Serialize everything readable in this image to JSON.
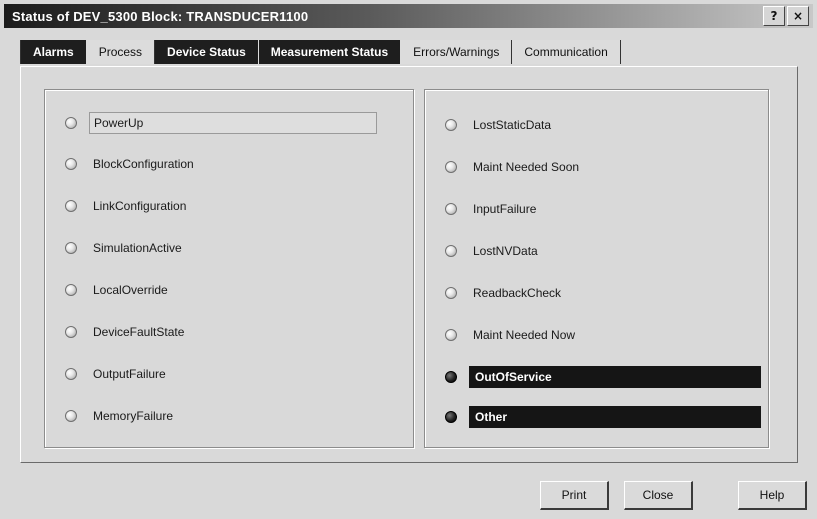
{
  "window": {
    "title": "Status of DEV_5300 Block: TRANSDUCER1100",
    "help_glyph": "?",
    "close_glyph": "×"
  },
  "tabs": [
    {
      "label": "Alarms",
      "style": "dark"
    },
    {
      "label": "Process",
      "style": "light"
    },
    {
      "label": "Device Status",
      "style": "dark"
    },
    {
      "label": "Measurement Status",
      "style": "dark"
    },
    {
      "label": "Errors/Warnings",
      "style": "light"
    },
    {
      "label": "Communication",
      "style": "light"
    }
  ],
  "left_group": {
    "items": [
      {
        "label": "PowerUp",
        "state": "off",
        "focused": true
      },
      {
        "label": "BlockConfiguration",
        "state": "off"
      },
      {
        "label": "LinkConfiguration",
        "state": "off"
      },
      {
        "label": "SimulationActive",
        "state": "off"
      },
      {
        "label": "LocalOverride",
        "state": "off"
      },
      {
        "label": "DeviceFaultState",
        "state": "off"
      },
      {
        "label": "OutputFailure",
        "state": "off"
      },
      {
        "label": "MemoryFailure",
        "state": "off"
      }
    ]
  },
  "right_group": {
    "items": [
      {
        "label": "LostStaticData",
        "state": "off"
      },
      {
        "label": "Maint Needed Soon",
        "state": "off"
      },
      {
        "label": "InputFailure",
        "state": "off"
      },
      {
        "label": "LostNVData",
        "state": "off"
      },
      {
        "label": "ReadbackCheck",
        "state": "off"
      },
      {
        "label": "Maint Needed Now",
        "state": "off"
      },
      {
        "label": "OutOfService",
        "state": "on"
      },
      {
        "label": "Other",
        "state": "on"
      }
    ]
  },
  "buttons": {
    "print": "Print",
    "close": "Close",
    "help": "Help"
  },
  "colors": {
    "active_indicator": "#151515",
    "inactive_indicator": "#e6e6e6",
    "dialog_background": "#d9d9d9"
  }
}
